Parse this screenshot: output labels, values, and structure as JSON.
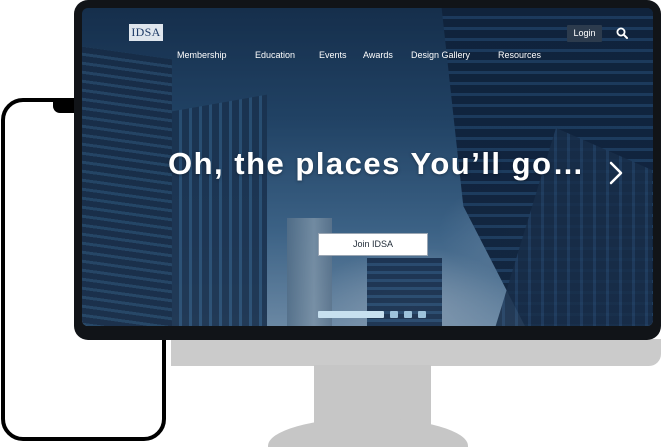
{
  "site": {
    "logo_text": "IDSA",
    "login_label": "Login",
    "search_icon": "search-icon"
  },
  "nav": {
    "items": [
      {
        "label": "Membership"
      },
      {
        "label": "Education"
      },
      {
        "label": "Events"
      },
      {
        "label": "Awards"
      },
      {
        "label": "Design Gallery"
      },
      {
        "label": "Resources"
      }
    ]
  },
  "hero": {
    "headline": "Oh, the places You’ll go…",
    "cta_label": "Join IDSA",
    "next_icon": "chevron-right-icon",
    "slides_total": 4,
    "active_slide": 1
  },
  "colors": {
    "monitor_bezel": "#111418",
    "stand": "#c6c6c6",
    "login_bg": "#2c3b4d",
    "phone_frame": "#000000"
  }
}
